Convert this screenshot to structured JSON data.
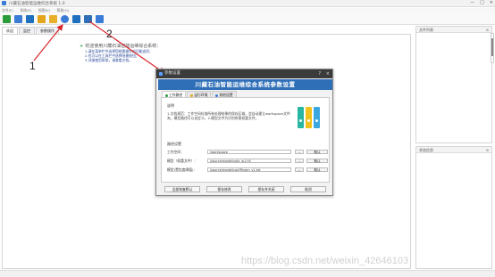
{
  "window": {
    "title": "川藏石油智能运维综合系统 1.0",
    "controls": [
      "—",
      "□",
      "×"
    ]
  },
  "menu": [
    "文件(F)",
    "系统(S)",
    "视图(V)",
    "帮助(H)"
  ],
  "toolbar_colors": [
    "#2a9d3a",
    "#3a7bd5",
    "#1f6fbf",
    "#e3a51b",
    "#e8b02a",
    "#3a7bd5",
    "#1f6fbf",
    "#2f6fb8",
    "#3a7bd5"
  ],
  "tabs": [
    "欢迎",
    "监控",
    "参数操作"
  ],
  "welcome": {
    "title": "欢迎使用川藏石油智能运维综合系统：",
    "lines": [
      "1.请在菜单栏中选择您想要操作的功能选项；",
      "2.也可以在工具栏中选择快捷按钮；",
      "3.详细使用帮助，请查看文档。"
    ]
  },
  "side_panels": {
    "top_title": "文件列表",
    "bottom_title": "状态信息",
    "pin": "⊞"
  },
  "annotations": {
    "one": "1",
    "two": "2"
  },
  "annotation_color": "#d9262b",
  "dialog": {
    "title": "参数设置",
    "help": "?",
    "close": "×",
    "banner": "川藏石油智能运维综合系统参数设置",
    "tabs": [
      "工作路径",
      "运行环境",
      "其他设置"
    ],
    "section1": "说明",
    "description": "1.文档规范：工作空间存放所有处理结果的保存区域，会自动建立workspace文件夹。模型路径可以自定义。2.模型文件为识别所需权重文件。",
    "section2": "路径设置",
    "rows": [
      {
        "label": "工作空间：",
        "value": "/workspace",
        "browse": "...",
        "default": "默认"
      },
      {
        "label": "模型（权重文件）：",
        "value": "/source/model/yolo_w1.h5",
        "browse": "...",
        "default": "默认"
      },
      {
        "label": "模型(置信度阈值)：",
        "value": "/source/model/confParam_v1.txt",
        "browse": "...",
        "default": "默认"
      }
    ],
    "buttons": [
      "全部恢复默认",
      "保存修改",
      "保存并关闭",
      "取消"
    ],
    "folder_colors": [
      "#29b6a3",
      "#f2c21c",
      "#3aa7e0"
    ]
  },
  "watermark": "https://blog.csdn.net/weixin_42646103"
}
